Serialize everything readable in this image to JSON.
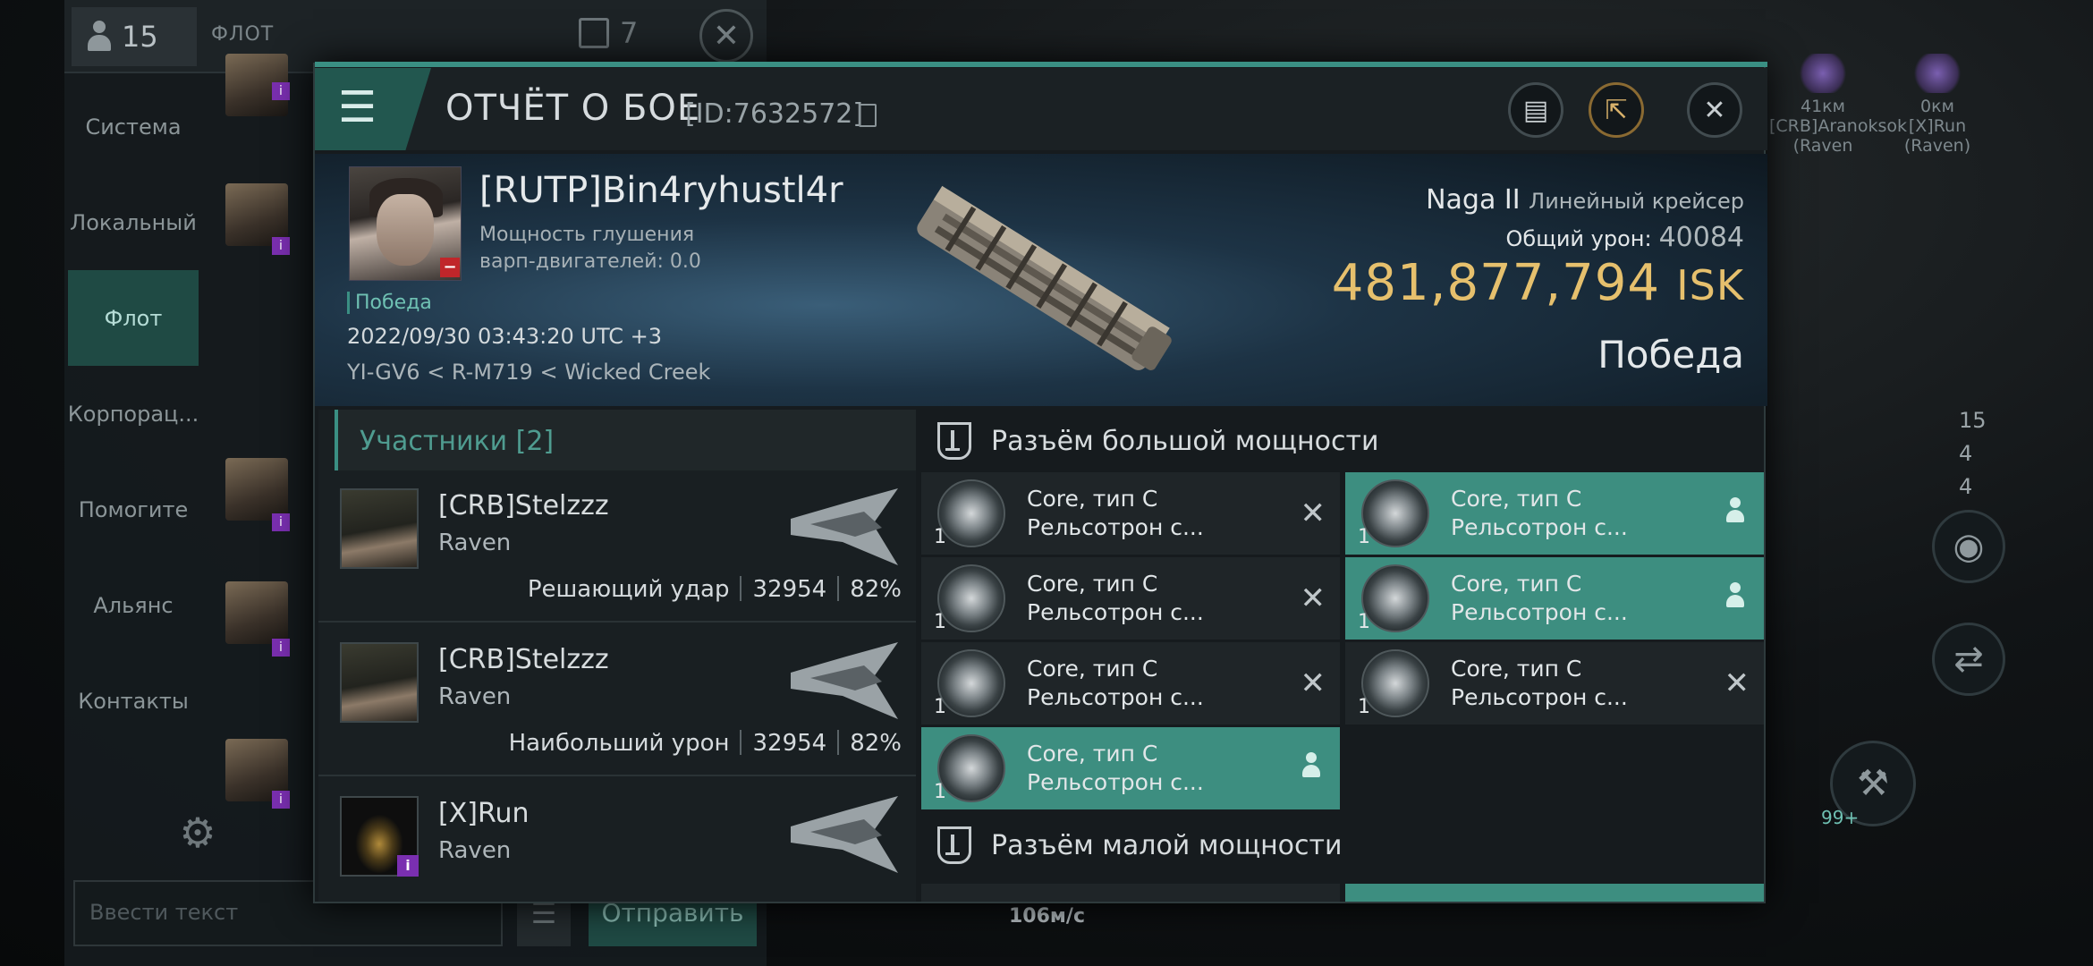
{
  "chat": {
    "member_count": "15",
    "title": "ФЛОТ",
    "unread": "7",
    "channels": [
      "Система",
      "Локальный",
      "Флот",
      "Корпорац...",
      "Помогите",
      "Альянс",
      "Контакты"
    ],
    "input_placeholder": "Ввести текст",
    "send_label": "Отправить"
  },
  "hud": {
    "targets": [
      {
        "distance": "41км",
        "name": "[CRB]Aranoksok",
        "ship": "(Raven"
      },
      {
        "distance": "0км",
        "name": "[X]Run",
        "ship": "(Raven)"
      }
    ],
    "stats": [
      "15",
      "4",
      "4"
    ],
    "speed": "106м/с",
    "badge": "99+"
  },
  "report": {
    "title": "ОТЧЁТ О БОЕ",
    "id": "[ID:7632572]",
    "victim": {
      "name": "[RUTP]Bin4ryhustl4r",
      "warp_label": "Мощность глушения варп-двигателей: 0.0",
      "result": "Победа",
      "time": "2022/09/30 03:43:20 UTC +3",
      "location": "YI-GV6 < R-M719 < Wicked Creek",
      "ship": "Naga II",
      "ship_class": "Линейный крейсер",
      "total_damage_label": "Общий урон:",
      "total_damage": "40084",
      "isk_value": "481,877,794",
      "isk_unit": "ISK",
      "outcome": "Победа"
    },
    "participants_label": "Участники [2]",
    "participants": [
      {
        "name": "[CRB]Stelzzz",
        "ship": "Raven",
        "role": "Решающий удар",
        "damage": "32954",
        "percent": "82%"
      },
      {
        "name": "[CRB]Stelzzz",
        "ship": "Raven",
        "role": "Наибольший урон",
        "damage": "32954",
        "percent": "82%"
      },
      {
        "name": "[X]Run",
        "ship": "Raven",
        "badge": "i"
      }
    ],
    "high_slots_label": "Разъём большой мощности",
    "low_slots_label": "Разъём малой мощности",
    "modules": [
      {
        "line1": "Core, тип C",
        "line2": "Рельсотрон с...",
        "qty": "1",
        "state": "destroyed"
      },
      {
        "line1": "Core, тип C",
        "line2": "Рельсотрон с...",
        "qty": "1",
        "state": "dropped"
      },
      {
        "line1": "Core, тип C",
        "line2": "Рельсотрон с...",
        "qty": "1",
        "state": "destroyed"
      },
      {
        "line1": "Core, тип C",
        "line2": "Рельсотрон с...",
        "qty": "1",
        "state": "dropped"
      },
      {
        "line1": "Core, тип C",
        "line2": "Рельсотрон с...",
        "qty": "1",
        "state": "destroyed"
      },
      {
        "line1": "Core, тип C",
        "line2": "Рельсотрон с...",
        "qty": "1",
        "state": "destroyed"
      },
      {
        "line1": "Core, тип C",
        "line2": "Рельсотрон с...",
        "qty": "1",
        "state": "dropped"
      }
    ]
  }
}
